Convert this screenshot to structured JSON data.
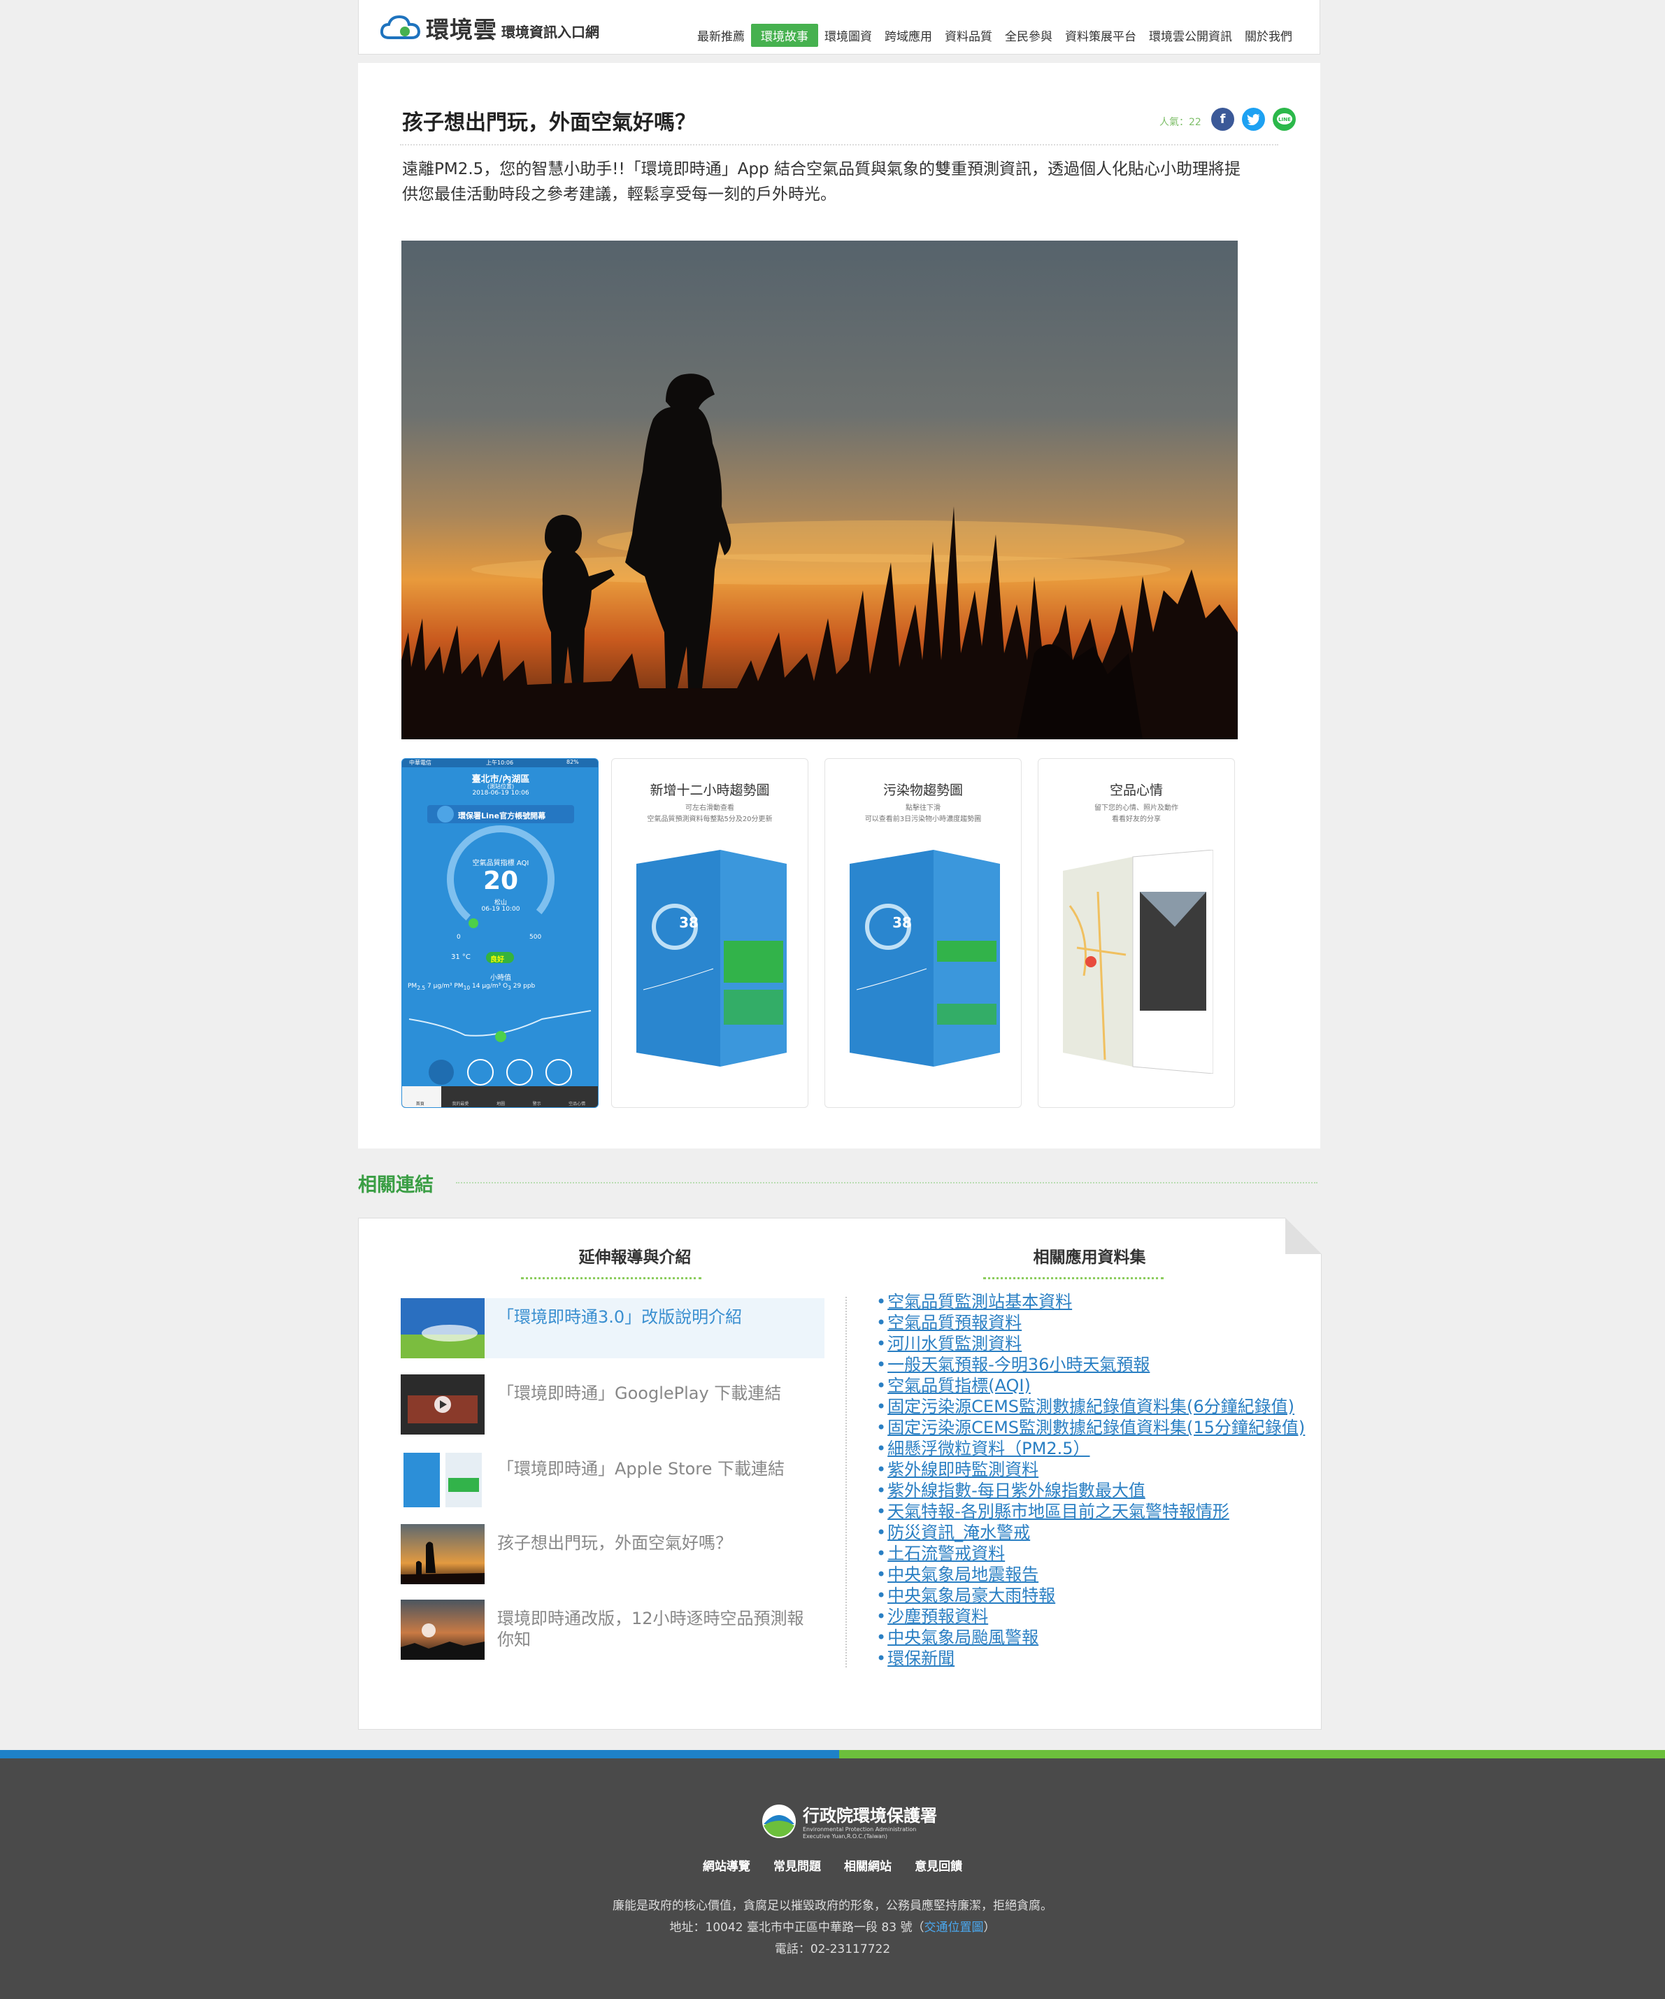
{
  "header": {
    "logo_text": "環境雲",
    "logo_sub": "環境資訊入口網",
    "nav": [
      "最新推薦",
      "環境故事",
      "環境圖資",
      "跨域應用",
      "資料品質",
      "全民參與",
      "資料策展平台",
      "環境雲公開資訊",
      "關於我們"
    ],
    "active_nav": "環境故事"
  },
  "article": {
    "title": "孩子想出門玩，外面空氣好嗎？",
    "popularity": "人氣：22",
    "intro": "遠離PM2.5，您的智慧小助手!!「環境即時通」App  結合空氣品質與氣象的雙重預測資訊，透過個人化貼心小助理將提供您最佳活動時段之參考建議，輕鬆享受每一刻的戶外時光。",
    "share_icons": [
      "facebook-icon",
      "twitter-icon",
      "line-icon"
    ]
  },
  "phone": {
    "carrier": "中華電信",
    "time": "上午10:06",
    "battery": "82%",
    "location": "臺北市/內湖區",
    "station": "(測站位置)",
    "datetime": "2018-06-19 10:06",
    "line_banner": "環保署Line官方帳號開幕",
    "aqi_label": "空氣品質指標 AQI",
    "aqi": "20",
    "site": "松山",
    "site_time": "06-19 10:00",
    "scale_min": "0",
    "scale_max": "500",
    "temp": "31 °C",
    "status": "良好",
    "hourly": "小時值",
    "pm25_label": "PM",
    "pm25_sub": "2.5",
    "pm25": "7",
    "pm10_label": "PM",
    "pm10_sub": "10",
    "pm10": "14",
    "o3_label": "O",
    "o3_sub": "3",
    "o3": "29",
    "unit_ug": "μg/m³",
    "unit_ppb": "ppb",
    "tabs": [
      "首頁",
      "我的最愛",
      "地圖",
      "警示",
      "空品心情"
    ]
  },
  "screens": [
    {
      "title": "新增十二小時趨勢圖",
      "sub1": "可左右滑動查看",
      "sub2": "空氣品質預測資料每整點5分及20分更新",
      "aqi": "38"
    },
    {
      "title": "污染物趨勢圖",
      "sub1": "點擊往下滑",
      "sub2": "可以查看前3日污染物小時濃度趨勢圖",
      "aqi": "38"
    },
    {
      "title": "空品心情",
      "sub1": "留下您的心情、照片及動作",
      "sub2": "看看好友的分享"
    }
  ],
  "related": {
    "heading": "相關連結",
    "left_title": "延伸報導與介紹",
    "right_title": "相關應用資料集",
    "articles": [
      "「環境即時通3.0」改版說明介紹",
      "「環境即時通」GooglePlay 下載連結",
      "「環境即時通」Apple Store 下載連結",
      "孩子想出門玩，外面空氣好嗎？",
      "環境即時通改版，12小時逐時空品預測報你知"
    ],
    "datasets": [
      "空氣品質監測站基本資料",
      "空氣品質預報資料",
      "河川水質監測資料",
      "一般天氣預報-今明36小時天氣預報",
      "空氣品質指標(AQI)",
      "固定污染源CEMS監測數據紀錄值資料集(6分鐘紀錄值)",
      "固定污染源CEMS監測數據紀錄值資料集(15分鐘紀錄值)",
      "細懸浮微粒資料（PM2.5）",
      "紫外線即時監測資料",
      "紫外線指數-每日紫外線指數最大值",
      "天氣特報-各別縣市地區目前之天氣警特報情形",
      "防災資訊_淹水警戒",
      "土石流警戒資料",
      "中央氣象局地震報告",
      "中央氣象局豪大雨特報",
      "沙塵預報資料",
      "中央氣象局颱風警報",
      "環保新聞"
    ]
  },
  "footer": {
    "org": "行政院環境保護署",
    "org_en1": "Environmental Protection Administration",
    "org_en2": "Executive Yuan,R.O.C.(Taiwan)",
    "links": [
      "網站導覽",
      "常見問題",
      "相關網站",
      "意見回饋"
    ],
    "line1": "廉能是政府的核心價值，貪腐足以摧毀政府的形象，公務員應堅持廉潔，拒絕貪腐。",
    "addr_pre": "地址：10042 臺北市中正區中華路一段 83 號（",
    "addr_link": "交通位置圖",
    "addr_post": "）",
    "phone": "電話：02-23117722"
  },
  "colors": {
    "accent_green": "#46b14f",
    "link_blue": "#2a7fc3",
    "footer_bg": "#4a4a4a",
    "bar_blue": "#1e81c8",
    "bar_green": "#6cbf3c"
  }
}
